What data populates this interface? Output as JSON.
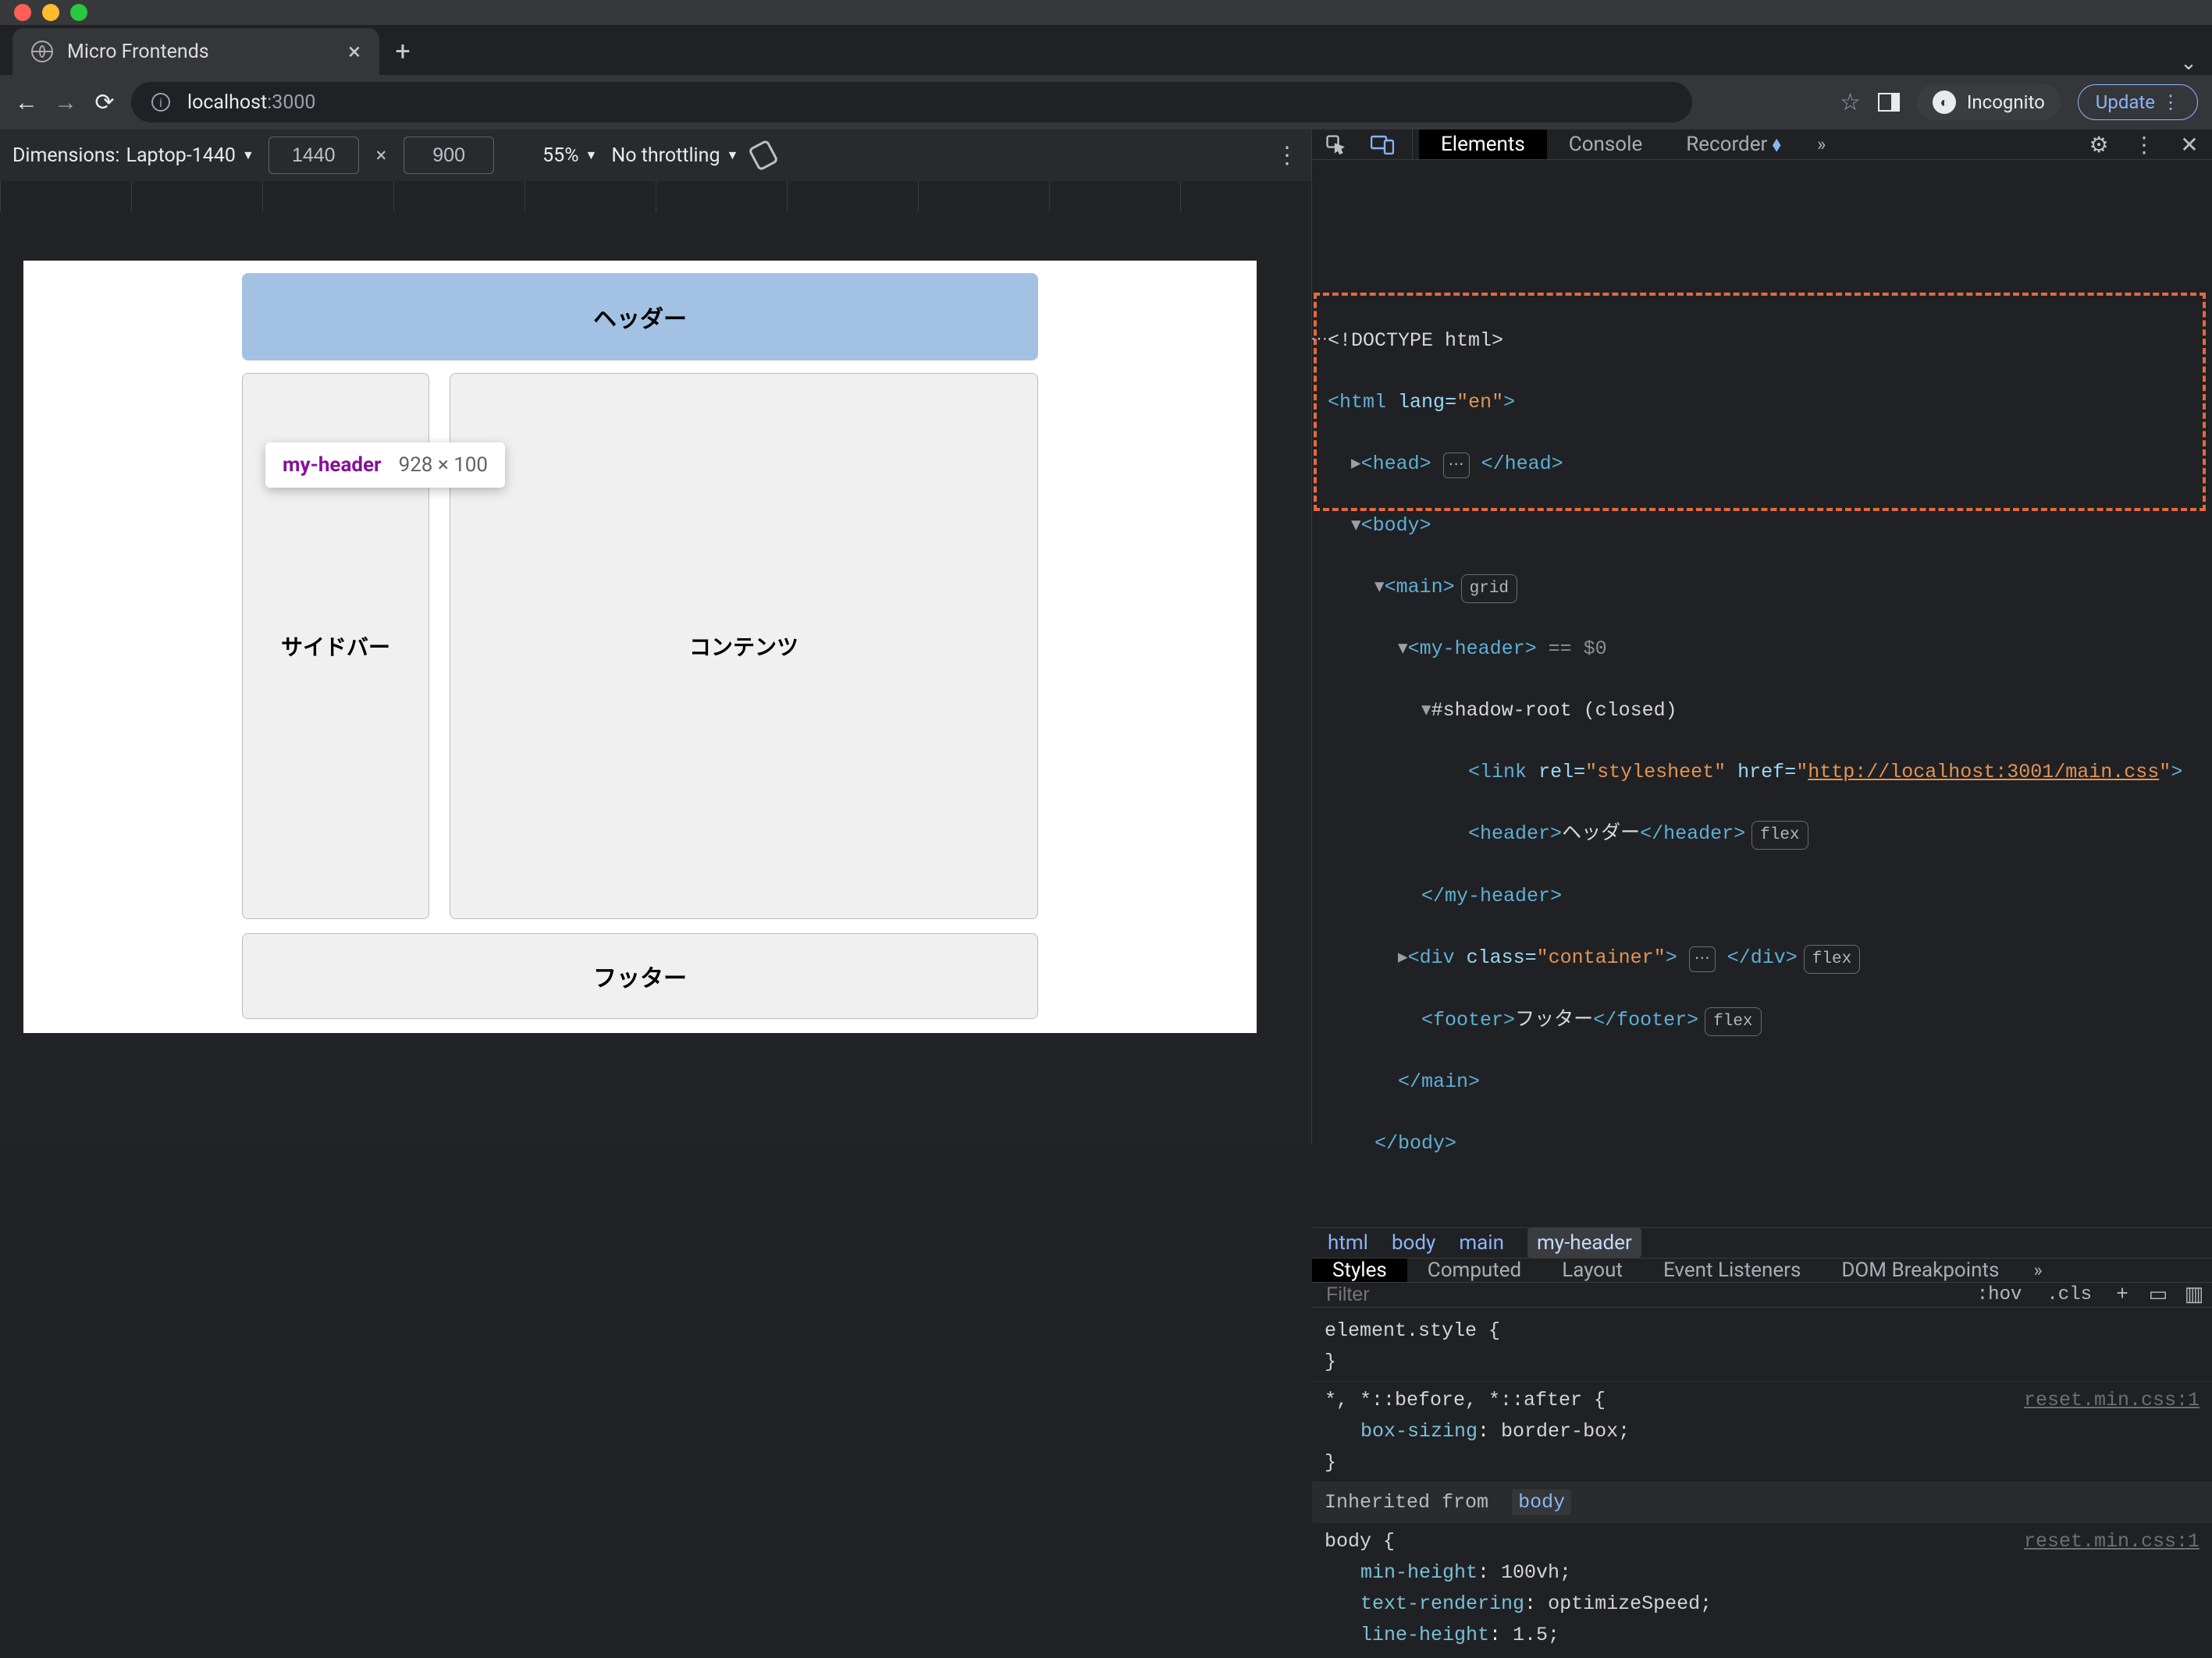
{
  "browser": {
    "tab_title": "Micro Frontends",
    "url_host": "localhost",
    "url_port": ":3000",
    "incognito_label": "Incognito",
    "update_label": "Update"
  },
  "device_toolbar": {
    "dimensions_label": "Dimensions:",
    "device_name": "Laptop-1440",
    "width": "1440",
    "height": "900",
    "zoom": "55%",
    "throttling": "No throttling"
  },
  "page": {
    "header": "ヘッダー",
    "sidebar": "サイドバー",
    "content": "コンテンツ",
    "footer": "フッター",
    "inspect_el": "my-header",
    "inspect_dims": "928 × 100"
  },
  "devtools": {
    "tabs": {
      "elements": "Elements",
      "console": "Console",
      "recorder": "Recorder"
    },
    "dom": {
      "doctype": "<!DOCTYPE html>",
      "html_open": "html",
      "html_lang": "en",
      "head": "head",
      "body": "body",
      "main": "main",
      "main_pill": "grid",
      "my_header": "my-header",
      "selected_marker": "== $0",
      "shadow": "#shadow-root (closed)",
      "link_rel": "stylesheet",
      "link_href": "http://localhost:3001/main.css",
      "header_tag": "header",
      "header_text": "ヘッダー",
      "container_class": "container",
      "container_pill": "flex",
      "footer_tag": "footer",
      "footer_text": "フッター",
      "footer_pill": "flex"
    },
    "breadcrumb": [
      "html",
      "body",
      "main",
      "my-header"
    ],
    "styles_tabs": {
      "styles": "Styles",
      "computed": "Computed",
      "layout": "Layout",
      "event_listeners": "Event Listeners",
      "dom_breakpoints": "DOM Breakpoints"
    },
    "filter_placeholder": "Filter",
    "filter_hov": ":hov",
    "filter_cls": ".cls",
    "styles": {
      "element_style": "element.style {",
      "close": "}",
      "star_sel": "*, *::before, *::after {",
      "star_prop": "box-sizing",
      "star_val": "border-box;",
      "source1": "reset.min.css:1",
      "inherited_label": "Inherited from",
      "inherited_from": "body",
      "body_sel": "body {",
      "body_p1n": "min-height",
      "body_p1v": "100vh;",
      "body_p2n": "text-rendering",
      "body_p2v": "optimizeSpeed;",
      "body_p3n": "line-height",
      "body_p3v": "1.5;",
      "source2": "reset.min.css:1"
    }
  }
}
